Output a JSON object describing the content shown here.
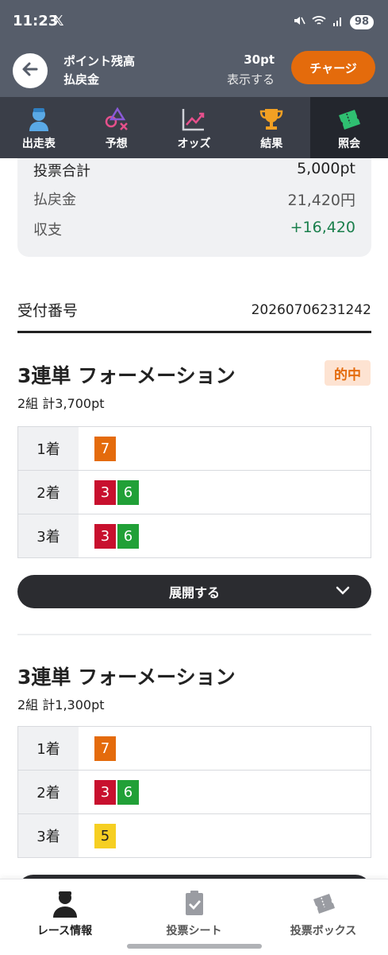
{
  "status_bar": {
    "time": "11:23",
    "battery": "98"
  },
  "header": {
    "label_points": "ポイント残高",
    "value_points": "30pt",
    "label_payout": "払戻金",
    "value_payout": "表示する",
    "charge_label": "チャージ"
  },
  "tabs": [
    {
      "label": "出走表",
      "icon": "person-icon"
    },
    {
      "label": "予想",
      "icon": "shapes-icon"
    },
    {
      "label": "オッズ",
      "icon": "chart-icon"
    },
    {
      "label": "結果",
      "icon": "trophy-icon"
    },
    {
      "label": "照会",
      "icon": "ticket-icon",
      "active": true
    }
  ],
  "summary": {
    "rows": [
      {
        "label": "投票合計",
        "value": "5,000pt"
      },
      {
        "label": "払戻金",
        "value": "21,420円"
      },
      {
        "label": "収支",
        "value": "+16,420"
      }
    ]
  },
  "receipt": {
    "label": "受付番号",
    "number": "20260706231242"
  },
  "bets": [
    {
      "title": "3連単 フォーメーション",
      "subtitle": "2組 計3,700pt",
      "badge": "的中",
      "rows": [
        {
          "pos": "1着",
          "nums": [
            "7"
          ]
        },
        {
          "pos": "2着",
          "nums": [
            "3",
            "6"
          ]
        },
        {
          "pos": "3着",
          "nums": [
            "3",
            "6"
          ]
        }
      ],
      "expand_label": "展開する"
    },
    {
      "title": "3連単 フォーメーション",
      "subtitle": "2組 計1,300pt",
      "rows": [
        {
          "pos": "1着",
          "nums": [
            "7"
          ]
        },
        {
          "pos": "2着",
          "nums": [
            "3",
            "6"
          ]
        },
        {
          "pos": "3着",
          "nums": [
            "5"
          ]
        }
      ]
    }
  ],
  "bottom_nav": [
    {
      "label": "レース情報",
      "icon": "race-person-icon",
      "active": true
    },
    {
      "label": "投票シート",
      "icon": "sheet-check-icon"
    },
    {
      "label": "投票ボックス",
      "icon": "box-ticket-icon"
    }
  ],
  "colors": {
    "header_bg": "#565d6a",
    "tab_bg": "#3a3e48",
    "accent": "#e46b0c",
    "profit_green": "#1a7f4c",
    "num_7": "#e46b0c",
    "num_3": "#c8102e",
    "num_6": "#21a037",
    "num_5": "#f6cf22"
  }
}
